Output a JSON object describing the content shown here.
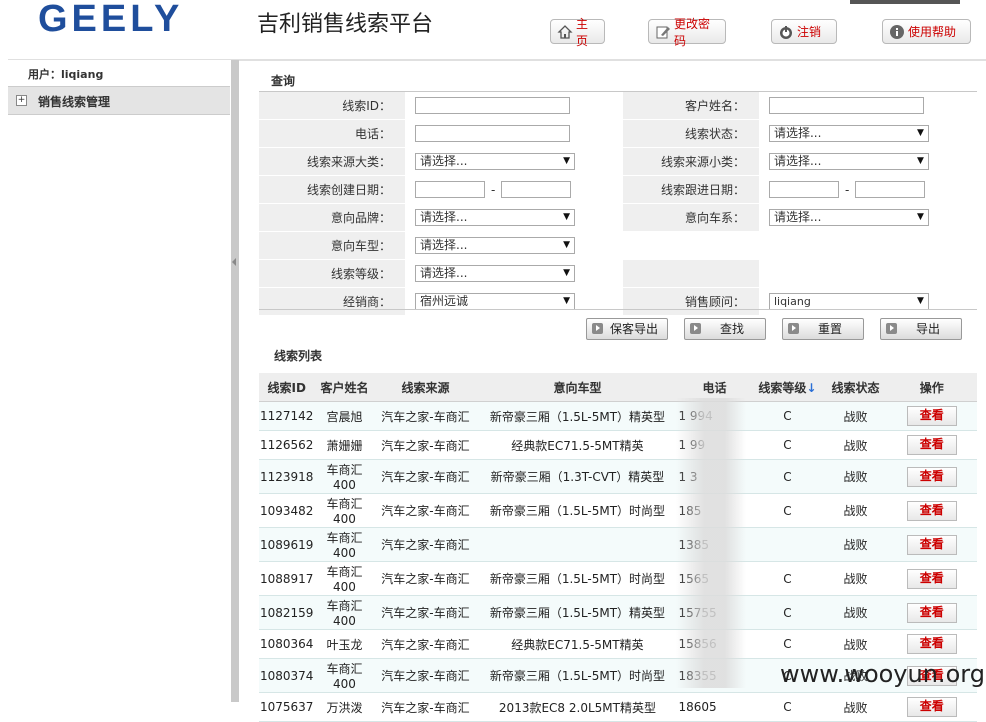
{
  "header": {
    "logo": "GEELY",
    "title": "吉利销售线索平台",
    "buttons": {
      "home": "主页",
      "password": "更改密码",
      "logout": "注销",
      "help": "使用帮助"
    }
  },
  "sidebar": {
    "user": "用户：liqiang",
    "menu": [
      {
        "label": "销售线索管理",
        "toggle": "+"
      }
    ]
  },
  "query": {
    "title": "查询",
    "fields": {
      "clue_id": {
        "label": "线索ID：",
        "value": ""
      },
      "customer_name": {
        "label": "客户姓名：",
        "value": ""
      },
      "phone": {
        "label": "电话：",
        "value": ""
      },
      "clue_status": {
        "label": "线索状态：",
        "value": "请选择..."
      },
      "source_major": {
        "label": "线索来源大类：",
        "value": "请选择..."
      },
      "source_minor": {
        "label": "线索来源小类：",
        "value": "请选择..."
      },
      "create_date": {
        "label": "线索创建日期：",
        "separator": "-"
      },
      "follow_date": {
        "label": "线索跟进日期：",
        "separator": "-"
      },
      "brand": {
        "label": "意向品牌：",
        "value": "请选择..."
      },
      "series": {
        "label": "意向车系：",
        "value": "请选择..."
      },
      "model": {
        "label": "意向车型：",
        "value": "请选择..."
      },
      "level": {
        "label": "线索等级：",
        "value": "请选择..."
      },
      "dealer": {
        "label": "经销商：",
        "value": "宿州远诚"
      },
      "consultant": {
        "label": "销售顾问：",
        "value": "liqiang"
      }
    },
    "actions": {
      "save_export": "保客导出",
      "search": "查找",
      "reset": "重置",
      "export": "导出"
    }
  },
  "list": {
    "title": "线索列表",
    "columns": [
      "线索ID",
      "客户姓名",
      "线索来源",
      "意向车型",
      "电话",
      "线索等级",
      "线索状态",
      "操作"
    ],
    "sort_indicator": "↓",
    "view_label": "查看",
    "rows": [
      {
        "id": "1127142",
        "name": "宫晨旭",
        "source": "汽车之家-车商汇",
        "model": "新帝豪三厢（1.5L-5MT）精英型",
        "phone": "1      994",
        "level": "C",
        "status": "战败"
      },
      {
        "id": "1126562",
        "name": "萧姗姗",
        "source": "汽车之家-车商汇",
        "model": "经典款EC71.5-5MT精英",
        "phone": "1      99",
        "level": "C",
        "status": "战败"
      },
      {
        "id": "1123918",
        "name": "车商汇400",
        "source": "汽车之家-车商汇",
        "model": "新帝豪三厢（1.3T-CVT）精英型",
        "phone": "1      3",
        "level": "C",
        "status": "战败"
      },
      {
        "id": "1093482",
        "name": "车商汇400",
        "source": "汽车之家-车商汇",
        "model": "新帝豪三厢（1.5L-5MT）时尚型",
        "phone": "185",
        "level": "C",
        "status": "战败"
      },
      {
        "id": "1089619",
        "name": "车商汇400",
        "source": "汽车之家-车商汇",
        "model": "",
        "phone": "1385",
        "level": "",
        "status": "战败"
      },
      {
        "id": "1088917",
        "name": "车商汇400",
        "source": "汽车之家-车商汇",
        "model": "新帝豪三厢（1.5L-5MT）时尚型",
        "phone": "1565",
        "level": "C",
        "status": "战败"
      },
      {
        "id": "1082159",
        "name": "车商汇400",
        "source": "汽车之家-车商汇",
        "model": "新帝豪三厢（1.5L-5MT）精英型",
        "phone": "15755",
        "level": "C",
        "status": "战败"
      },
      {
        "id": "1080364",
        "name": "叶玉龙",
        "source": "汽车之家-车商汇",
        "model": "经典款EC71.5-5MT精英",
        "phone": "15856",
        "level": "C",
        "status": "战败"
      },
      {
        "id": "1080374",
        "name": "车商汇400",
        "source": "汽车之家-车商汇",
        "model": "新帝豪三厢（1.5L-5MT）时尚型",
        "phone": "18355",
        "level": "C",
        "status": "战败"
      },
      {
        "id": "1075637",
        "name": "万洪泼",
        "source": "汽车之家-车商汇",
        "model": "2013款EC8 2.0L5MT精英型",
        "phone": "18605",
        "level": "C",
        "status": "战败"
      }
    ]
  },
  "watermark": "www.wooyun.org"
}
